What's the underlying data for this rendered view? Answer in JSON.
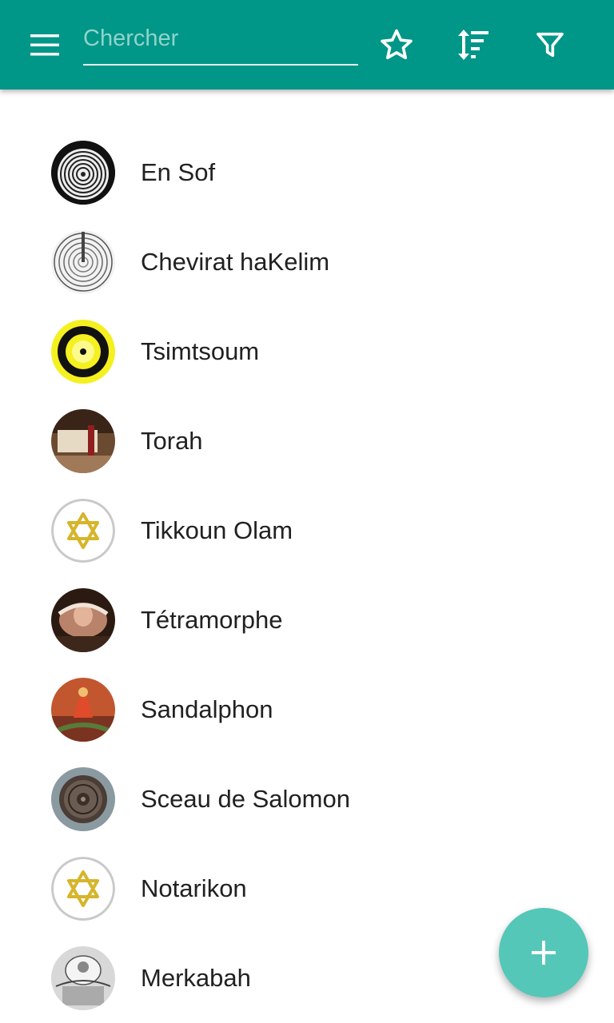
{
  "search": {
    "placeholder": "Chercher",
    "value": ""
  },
  "toolbar": {
    "background": "#009688",
    "icons": {
      "menu": "menu-icon",
      "favorites": "star-outline-icon",
      "sort": "sort-icon",
      "filter": "filter-icon"
    }
  },
  "items": [
    {
      "label": "En Sof",
      "icon": "en-sof-thumbnail"
    },
    {
      "label": "Chevirat haKelim",
      "icon": "chevirat-thumbnail"
    },
    {
      "label": "Tsimtsoum",
      "icon": "tsimtsoum-thumbnail"
    },
    {
      "label": "Torah",
      "icon": "torah-thumbnail"
    },
    {
      "label": "Tikkoun Olam",
      "icon": "star-of-david-thumbnail"
    },
    {
      "label": "Tétramorphe",
      "icon": "tetramorphe-thumbnail"
    },
    {
      "label": "Sandalphon",
      "icon": "sandalphon-thumbnail"
    },
    {
      "label": "Sceau de Salomon",
      "icon": "seal-thumbnail"
    },
    {
      "label": "Notarikon",
      "icon": "star-of-david-thumbnail"
    },
    {
      "label": "Merkabah",
      "icon": "merkabah-thumbnail"
    }
  ],
  "fab": {
    "icon": "plus-icon",
    "color": "#54c7b8"
  }
}
